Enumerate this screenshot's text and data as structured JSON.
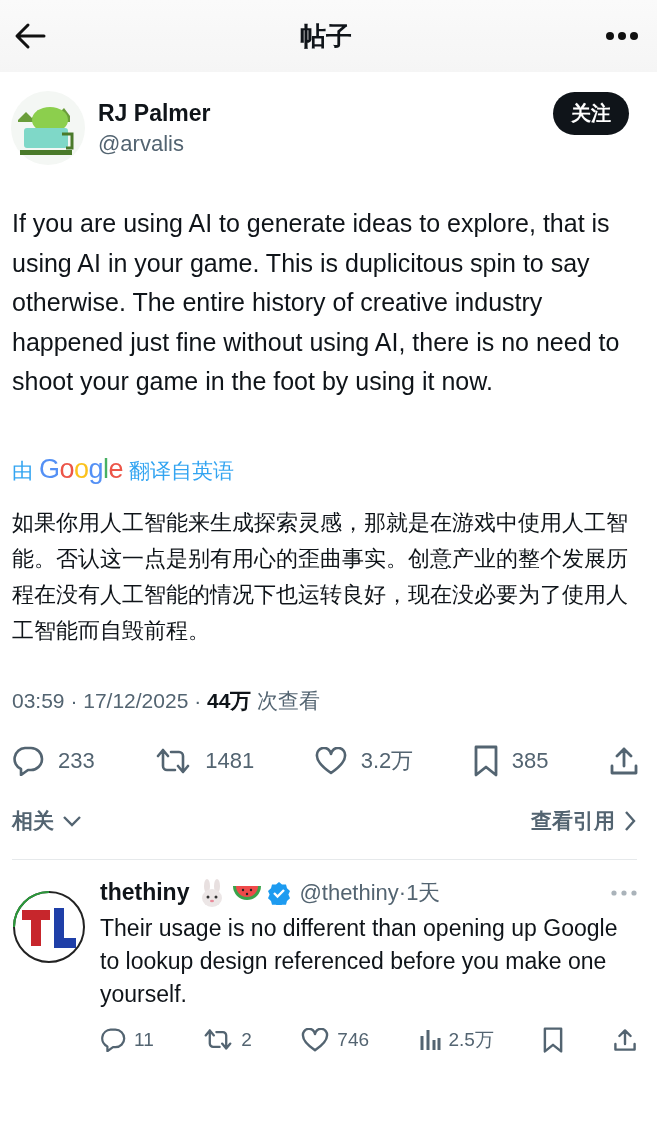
{
  "header": {
    "title": "帖子"
  },
  "post": {
    "author": {
      "name": "RJ Palmer",
      "handle": "@arvalis"
    },
    "follow_button": "关注",
    "text": "If you are using AI to generate ideas to explore, that is using AI in your game. This is duplicitous spin to say otherwise. The entire history of creative industry happened just fine without using AI, there is no need to shoot your game in the foot by using it now.",
    "translation": {
      "prefix": "由",
      "brand": "Google",
      "suffix": "翻译自英语",
      "text": "如果你用人工智能来生成探索灵感，那就是在游戏中使用人工智能。否认这一点是别有用心的歪曲事实。创意产业的整个发展历程在没有人工智能的情况下也运转良好，现在没必要为了使用人工智能而自毁前程。"
    },
    "meta": "03:59 · 17/12/2025 · **44万** 次查看",
    "actions": [
      {
        "kind": "reply",
        "count": "233"
      },
      {
        "kind": "repost",
        "count": "1481"
      },
      {
        "kind": "like",
        "count": "3.2万"
      },
      {
        "kind": "bookmark",
        "count": "385"
      },
      {
        "kind": "share"
      }
    ]
  },
  "related": {
    "label": "相关",
    "quotes_link": "查看引用"
  },
  "reply": {
    "author": {
      "name": "thethiny",
      "verified": true,
      "handle": "@thethiny·1天"
    },
    "text": "Their usage is no different than opening up Google to lookup design referenced before you make one yourself.",
    "actions": [
      {
        "kind": "reply",
        "count": "11"
      },
      {
        "kind": "repost",
        "count": "2"
      },
      {
        "kind": "like",
        "count": "746"
      },
      {
        "kind": "views",
        "count": "2.5万"
      },
      {
        "kind": "bookmark"
      },
      {
        "kind": "share"
      }
    ]
  }
}
